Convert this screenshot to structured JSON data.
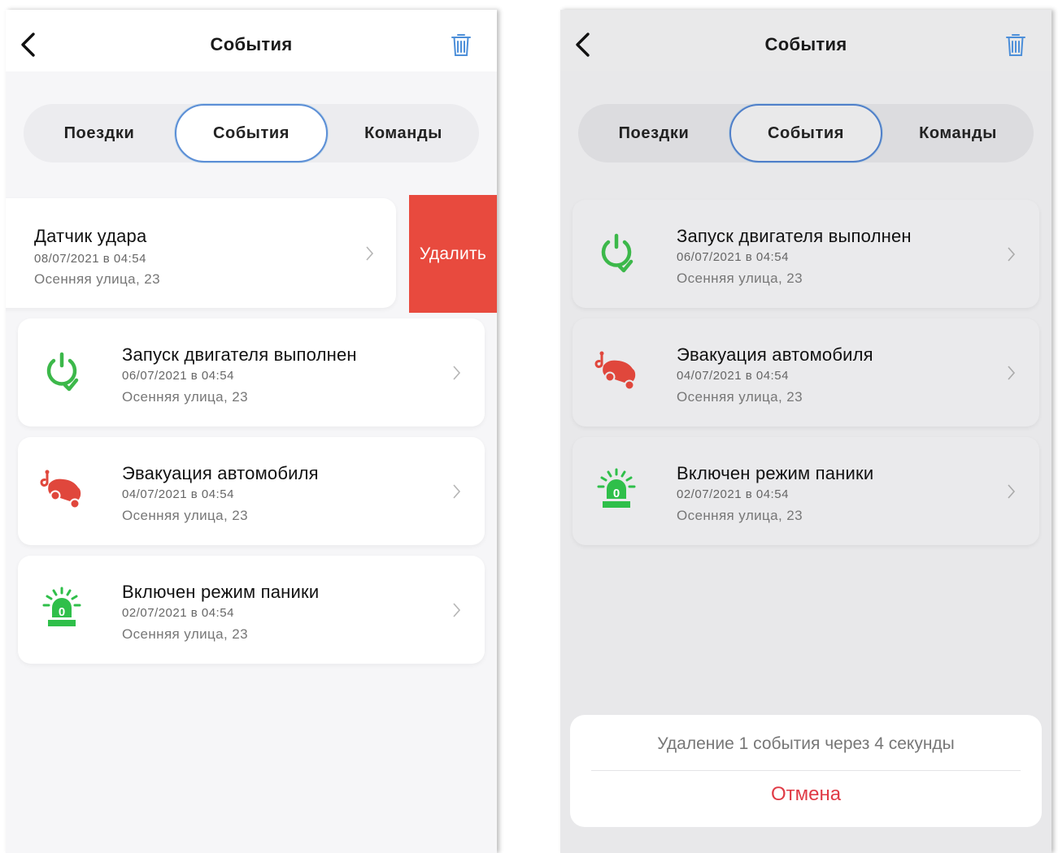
{
  "colors": {
    "accent_outline": "#5b8ed6",
    "delete_red": "#e84a3e",
    "cancel_red": "#e03a45",
    "engine_green": "#3cb84a",
    "tow_red": "#e0473c",
    "panic_green": "#2fbf4a",
    "trash_blue": "#4d8fd9"
  },
  "left": {
    "nav": {
      "title": "События",
      "back_icon": "chevron-left-icon",
      "trash_icon": "trash-icon"
    },
    "tabs": [
      {
        "label": "Поездки",
        "active": false
      },
      {
        "label": "События",
        "active": true
      },
      {
        "label": "Команды",
        "active": false
      }
    ],
    "swiped_event": {
      "title": "Датчик удара",
      "date": "08/07/2021 в 04:54",
      "address": "Осенняя улица, 23",
      "delete_label": "Удалить"
    },
    "events": [
      {
        "icon": "engine-start-icon",
        "title": "Запуск двигателя выполнен",
        "date": "06/07/2021 в 04:54",
        "address": "Осенняя улица, 23"
      },
      {
        "icon": "tow-truck-icon",
        "title": "Эвакуация автомобиля",
        "date": "04/07/2021 в 04:54",
        "address": "Осенняя улица, 23"
      },
      {
        "icon": "panic-siren-icon",
        "title": "Включен режим паники",
        "date": "02/07/2021 в 04:54",
        "address": "Осенняя улица, 23"
      }
    ]
  },
  "right": {
    "nav": {
      "title": "События",
      "back_icon": "chevron-left-icon",
      "trash_icon": "trash-icon"
    },
    "tabs": [
      {
        "label": "Поездки",
        "active": false
      },
      {
        "label": "События",
        "active": true
      },
      {
        "label": "Команды",
        "active": false
      }
    ],
    "events": [
      {
        "icon": "engine-start-icon",
        "title": "Запуск двигателя выполнен",
        "date": "06/07/2021 в 04:54",
        "address": "Осенняя улица, 23"
      },
      {
        "icon": "tow-truck-icon",
        "title": "Эвакуация автомобиля",
        "date": "04/07/2021 в 04:54",
        "address": "Осенняя улица, 23"
      },
      {
        "icon": "panic-siren-icon",
        "title": "Включен режим паники",
        "date": "02/07/2021 в 04:54",
        "address": "Осенняя улица, 23"
      }
    ],
    "toast": {
      "message": "Удаление 1 события через 4 секунды",
      "cancel_label": "Отмена"
    }
  },
  "panic_badge_digit": "0"
}
